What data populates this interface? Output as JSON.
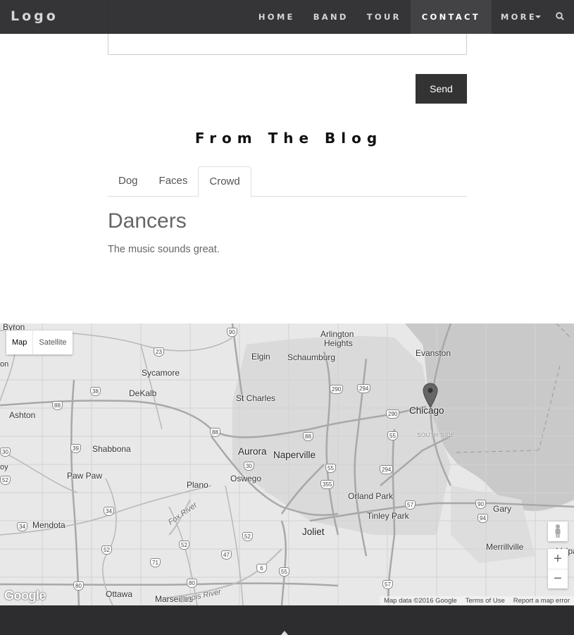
{
  "nav": {
    "brand": "Logo",
    "items": [
      {
        "label": "HOME"
      },
      {
        "label": "BAND"
      },
      {
        "label": "TOUR"
      },
      {
        "label": "CONTACT"
      },
      {
        "label": "MORE"
      }
    ],
    "search_icon": "search-icon"
  },
  "contact": {
    "send_label": "Send"
  },
  "blog": {
    "title": "From The Blog",
    "tabs": [
      "Dog",
      "Faces",
      "Crowd"
    ],
    "active_tab": "Crowd",
    "post_title": "Dancers",
    "post_text": "The music sounds great."
  },
  "map": {
    "type_map": "Map",
    "type_satellite": "Satellite",
    "zoom_in": "+",
    "zoom_out": "−",
    "google": "Google",
    "data": "Map data ©2016 Google",
    "terms": "Terms of Use",
    "report": "Report a map error",
    "places": {
      "byron": "Byron",
      "arlington": "Arlington",
      "heights": "Heights",
      "elgin": "Elgin",
      "schaumburg": "Schaumburg",
      "evanston": "Evanston",
      "sycamore": "Sycamore",
      "dekalb": "DeKalb",
      "stcharles": "St Charles",
      "chicago": "Chicago",
      "ashton": "Ashton",
      "southside": "SOUTH SIDE",
      "shabbona": "Shabbona",
      "aurora": "Aurora",
      "naperville": "Naperville",
      "pawpaw": "Paw Paw",
      "oswego": "Oswego",
      "plano": "Plano",
      "orland": "Orland Park",
      "gary": "Gary",
      "tinley": "Tinley Park",
      "mendota": "Mendota",
      "foxriver": "Fox River",
      "joliet": "Joliet",
      "merrillville": "Merrillville",
      "ottawa": "Ottawa",
      "marseilles": "Marseilles",
      "illinoisriver": "Illinois River",
      "valpa": "Valpa",
      "on": "on",
      "oy": "oy"
    },
    "shields": [
      "90",
      "23",
      "290",
      "294",
      "38",
      "88",
      "88",
      "39",
      "55",
      "30",
      "30",
      "52",
      "55",
      "294",
      "355",
      "57",
      "90",
      "94",
      "34",
      "34",
      "52",
      "52",
      "71",
      "47",
      "6",
      "55",
      "80",
      "80",
      "57",
      "88",
      "90",
      "57"
    ]
  },
  "colors": {
    "nav_bg": "#2d2d30",
    "button_bg": "#333333",
    "map_land": "#e8e8e8",
    "map_water": "#c9c9c9"
  }
}
